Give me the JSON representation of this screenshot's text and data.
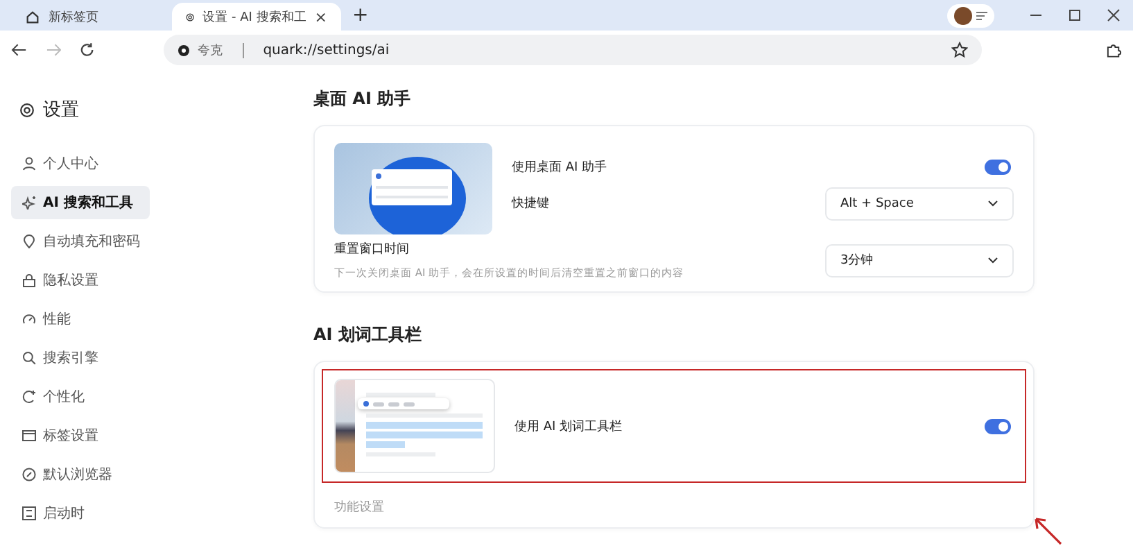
{
  "tabs": [
    {
      "label": "新标签页",
      "selected": false,
      "kind": "home"
    },
    {
      "label": "设置 - AI 搜索和工",
      "selected": true,
      "kind": "settings",
      "close": "×"
    }
  ],
  "new_tab": "+",
  "address_bar": {
    "site": "夸克",
    "url": "quark://settings/ai"
  },
  "sidebar": {
    "title": "设置",
    "items": [
      {
        "label": "个人中心",
        "selected": false
      },
      {
        "label": "AI 搜索和工具",
        "selected": true
      },
      {
        "label": "自动填充和密码",
        "selected": false
      },
      {
        "label": "隐私设置",
        "selected": false
      },
      {
        "label": "性能",
        "selected": false
      },
      {
        "label": "搜索引擎",
        "selected": false
      },
      {
        "label": "个性化",
        "selected": false
      },
      {
        "label": "标签设置",
        "selected": false
      },
      {
        "label": "默认浏览器",
        "selected": false
      },
      {
        "label": "启动时",
        "selected": false
      }
    ]
  },
  "sections": [
    {
      "title": "桌面 AI 助手",
      "toggle_label": "使用桌面 AI 助手",
      "on": true,
      "highlighted": false,
      "shortcut": {
        "label": "快捷键",
        "value": "Alt + Space"
      },
      "reset": {
        "label": "重置窗口时间",
        "description": "下一次关闭桌面 AI 助手，会在所设置的时间后清空重置之前窗口的内容",
        "value": "3分钟"
      }
    },
    {
      "title": "AI 划词工具栏",
      "toggle_label": "使用 AI 划词工具栏",
      "on": true,
      "highlighted": true,
      "subheading": "功能设置"
    }
  ]
}
